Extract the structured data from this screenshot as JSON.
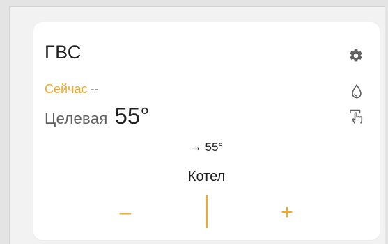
{
  "card": {
    "title": "ГВС",
    "now_label": "Сейчас",
    "now_value": "--",
    "target_label": "Целевая",
    "target_value": "55°",
    "setpoint_text": "→ 55°",
    "source_label": "Котел",
    "minus_label": "–",
    "plus_label": "+"
  },
  "icons": {
    "settings": "gear-icon",
    "water": "water-drop-icon",
    "manual": "touch-hand-icon"
  },
  "colors": {
    "accent": "#f5a623",
    "text": "#212121",
    "muted": "#616161",
    "icon": "#616161",
    "background": "#f2f2f2",
    "card": "#ffffff"
  }
}
